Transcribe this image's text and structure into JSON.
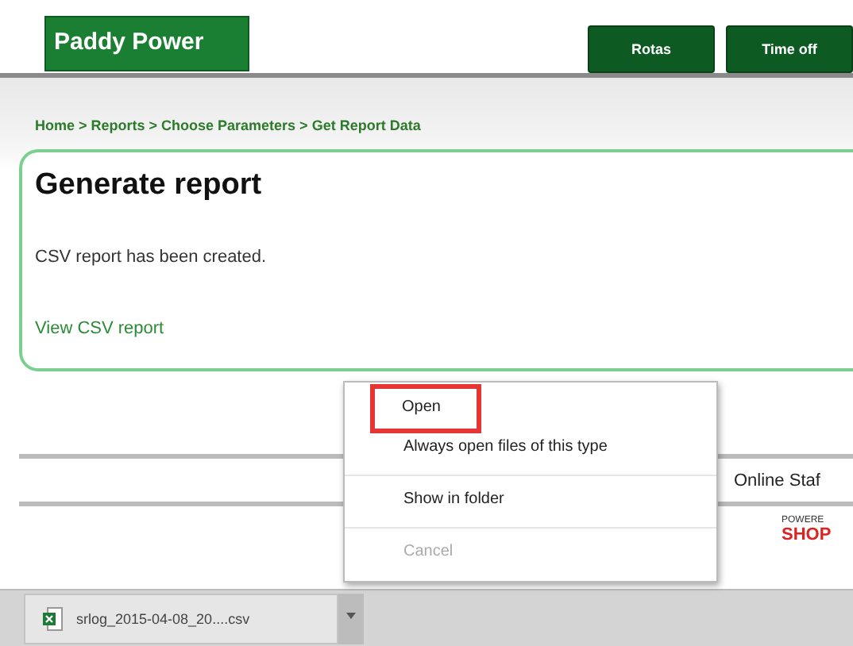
{
  "header": {
    "logo": "Paddy Power",
    "nav_buttons": [
      "Rotas",
      "Time off"
    ]
  },
  "breadcrumb": "Home > Reports > Choose Parameters > Get Report Data",
  "card": {
    "title": "Generate report",
    "message": "CSV report has been created.",
    "link": "View CSV report"
  },
  "footer": {
    "staff_label": "Online Staf",
    "powered_label": "POWERE",
    "shop_label": "SHOP"
  },
  "download": {
    "filename": "srlog_2015-04-08_20....csv"
  },
  "context_menu": {
    "items": [
      {
        "label": "Open",
        "disabled": false,
        "highlighted": true
      },
      {
        "label": "Always open files of this type",
        "disabled": false,
        "highlighted": false
      },
      {
        "label": "Show in folder",
        "disabled": false,
        "highlighted": false
      },
      {
        "label": "Cancel",
        "disabled": true,
        "highlighted": false
      }
    ]
  }
}
